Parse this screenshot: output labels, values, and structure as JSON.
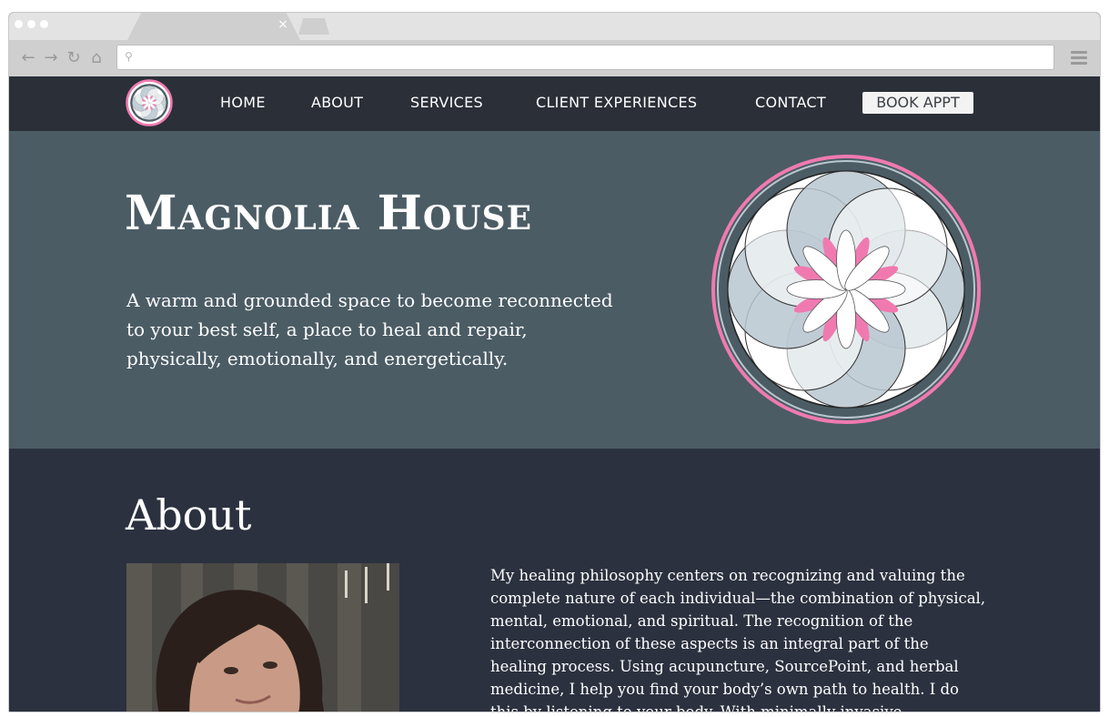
{
  "browser": {
    "tab_close_glyph": "×",
    "url": "",
    "nav_glyphs": {
      "back": "←",
      "forward": "→",
      "reload": "↻",
      "home": "⌂"
    }
  },
  "site": {
    "nav": {
      "items": [
        {
          "label": "HOME"
        },
        {
          "label": "ABOUT"
        },
        {
          "label": "SERVICES"
        },
        {
          "label": "CLIENT EXPERIENCES"
        },
        {
          "label": "CONTACT"
        }
      ],
      "book_label": "BOOK APPT"
    },
    "hero": {
      "title": "Magnolia House",
      "text": "A warm and grounded space to become reconnected to your best self, a place to heal and repair, physically, emotionally, and energetically."
    },
    "about": {
      "title": "About",
      "text": "My healing philosophy centers on recognizing and valuing the complete nature of each individual—the combination of physical, mental, emotional, and spiritual. The recognition of the interconnection of these aspects is an integral part of the healing process. Using acupuncture, SourcePoint, and herbal medicine, I help you find your body’s own path to health. I do this by listening to your body. With minimally invasive techniques, I listen to your"
    },
    "colors": {
      "nav_bg": "#2a2f38",
      "hero_bg": "#4b5c65",
      "about_bg": "#2b313f",
      "accent_pink": "#f07ab0",
      "petal_blue": "#b9c7d0"
    },
    "icons": [
      "search-icon",
      "back-arrow-icon",
      "forward-arrow-icon",
      "reload-icon",
      "home-icon",
      "menu-icon",
      "close-icon",
      "lotus-logo-icon"
    ]
  }
}
